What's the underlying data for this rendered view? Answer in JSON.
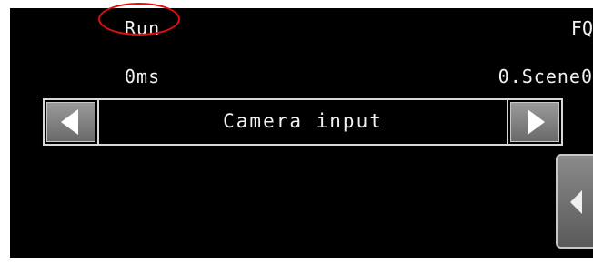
{
  "status": {
    "mode": "Run",
    "product": "FQ",
    "time": "0ms",
    "scene": "0.Scene0"
  },
  "navigator": {
    "title": "Camera input",
    "prev_icon": "triangle-left-icon",
    "next_icon": "triangle-right-icon"
  },
  "side_panel": {
    "icon": "triangle-left-icon"
  },
  "colors": {
    "screen_background": "#000000",
    "text": "#f2f2f2",
    "highlight": "#e01010",
    "button_gray": "#808080"
  }
}
